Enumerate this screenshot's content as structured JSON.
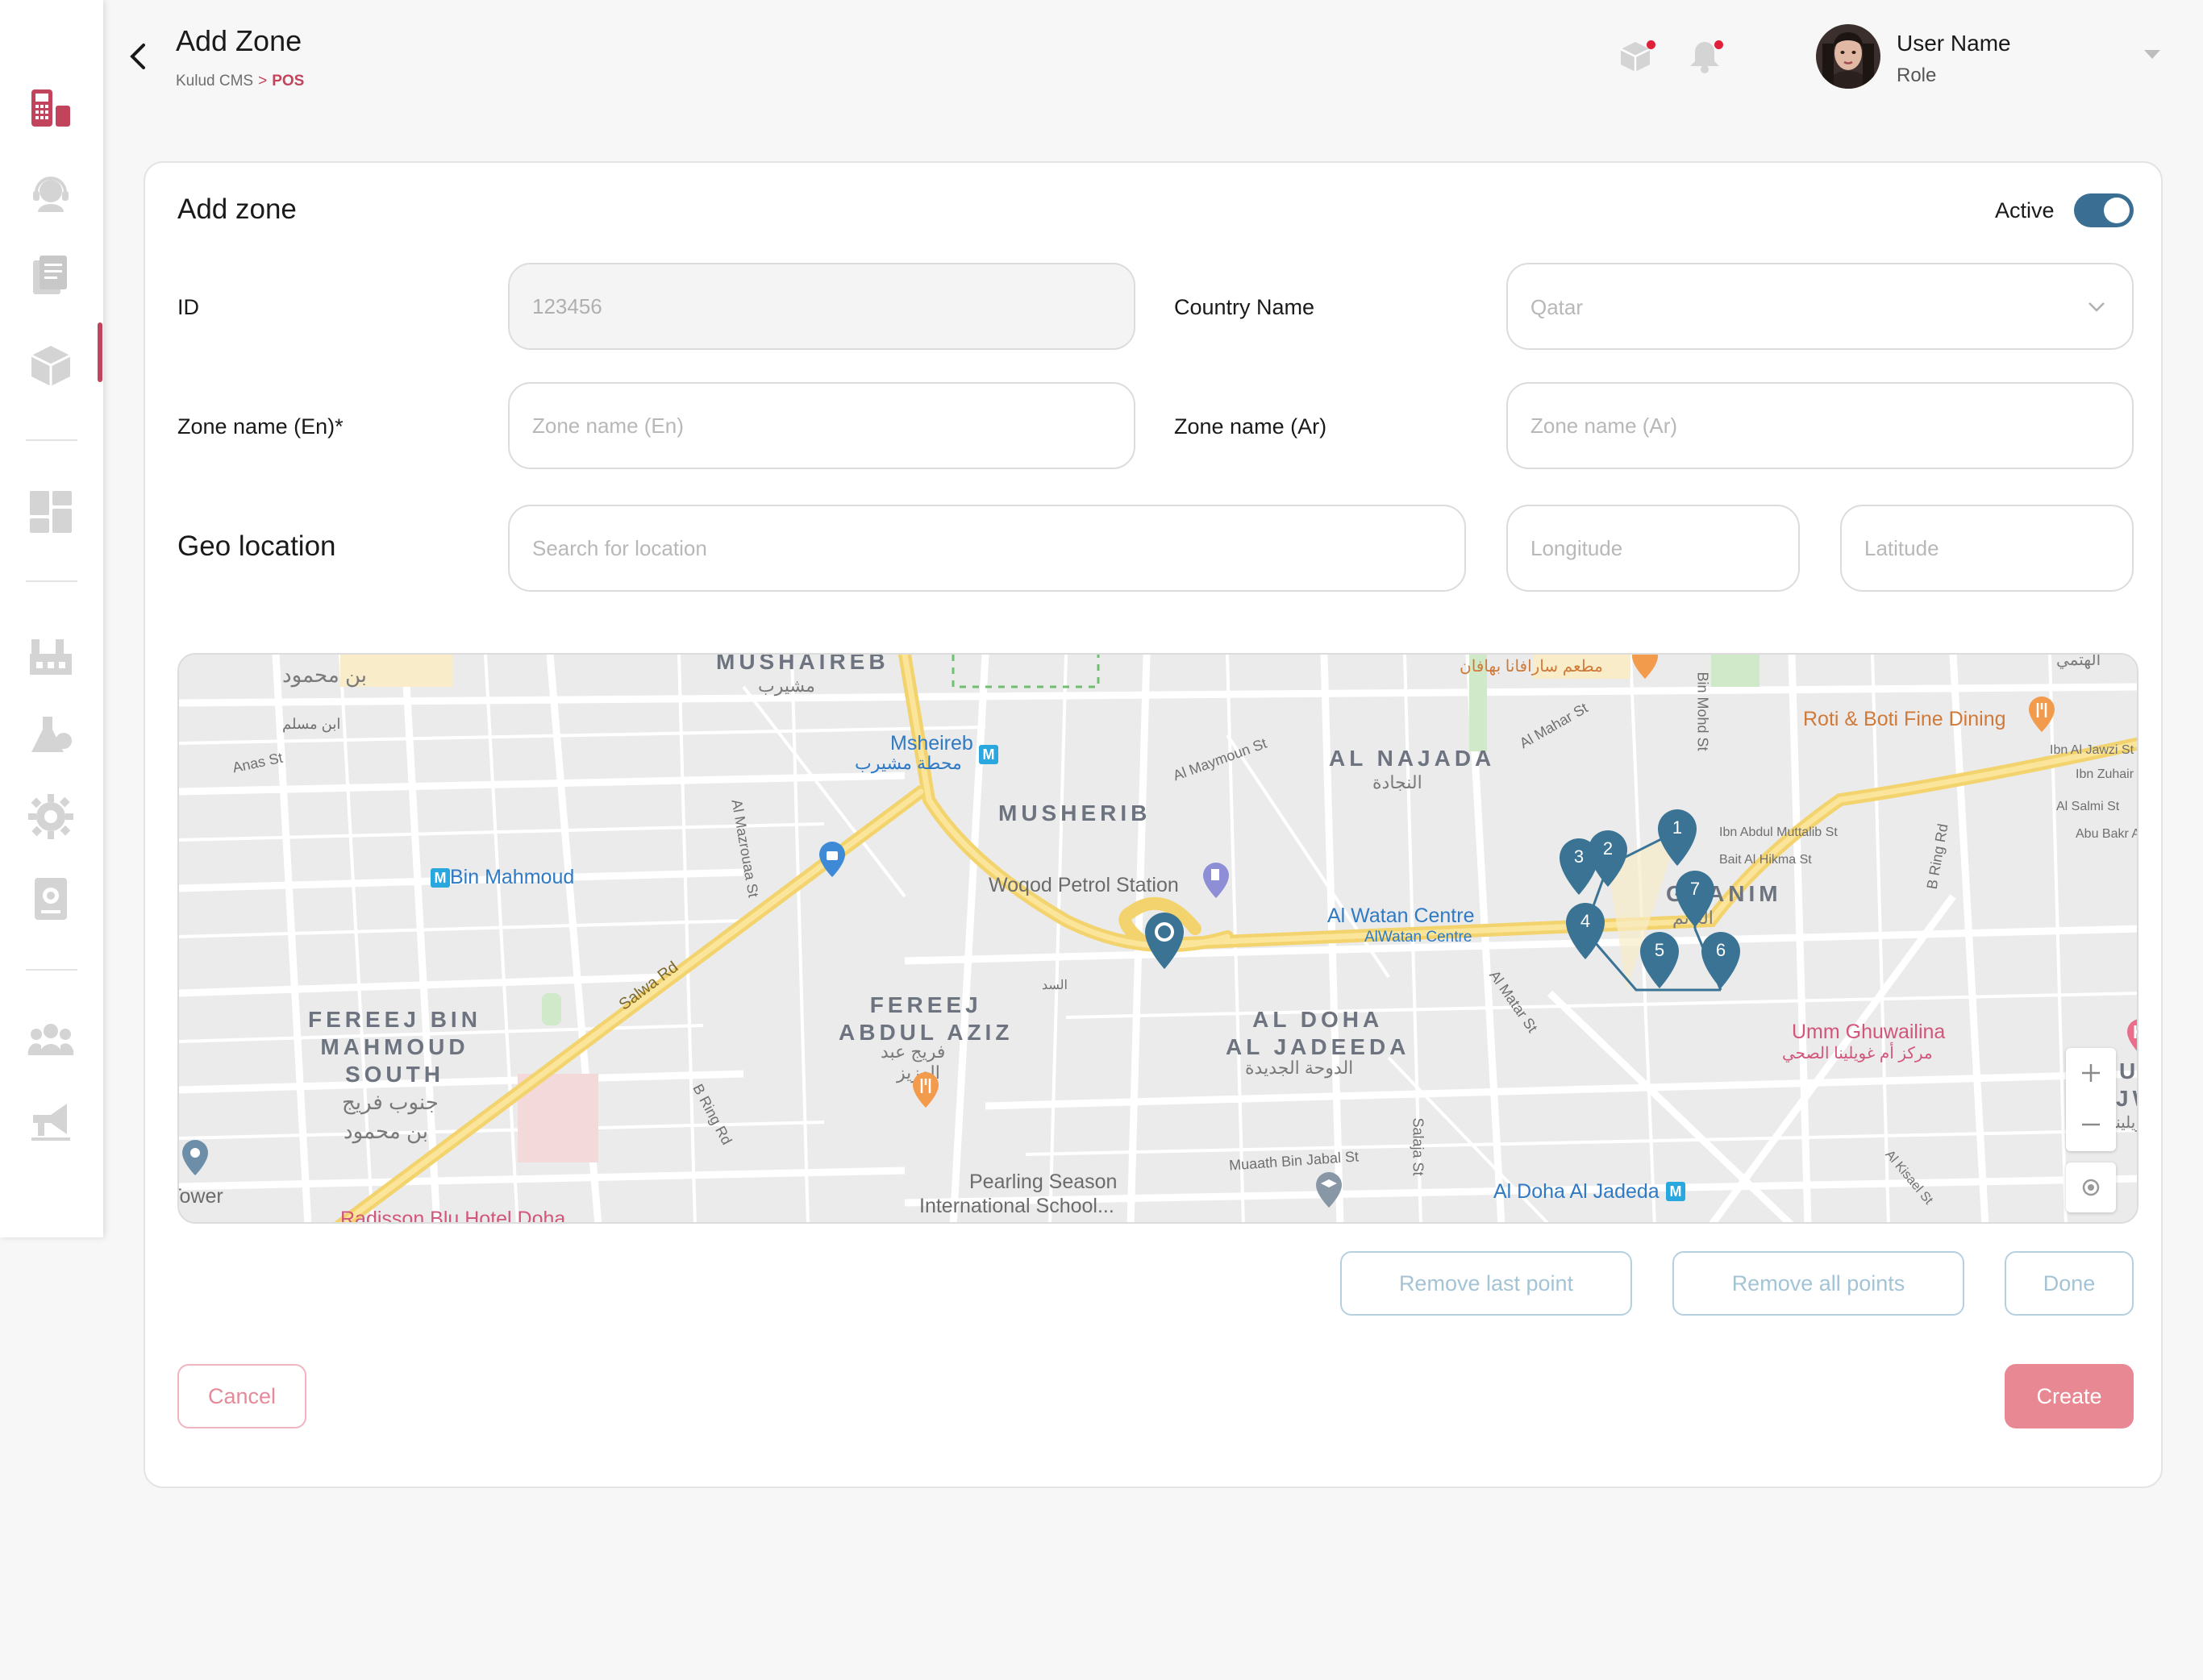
{
  "header": {
    "title": "Add Zone",
    "breadcrumb": {
      "root": "Kulud CMS",
      "separator": ">",
      "current": "POS"
    },
    "user": {
      "name": "User Name",
      "role": "Role"
    }
  },
  "sidebar": {
    "items": [
      {
        "icon": "pos-terminal-icon",
        "active": true
      },
      {
        "icon": "support-agent-icon"
      },
      {
        "icon": "documents-icon"
      },
      {
        "icon": "box-icon"
      },
      {
        "icon": "dashboard-grid-icon"
      },
      {
        "icon": "factory-icon"
      },
      {
        "icon": "lab-flask-icon"
      },
      {
        "icon": "settings-gear-icon"
      },
      {
        "icon": "device-settings-icon"
      },
      {
        "icon": "users-group-icon"
      },
      {
        "icon": "megaphone-icon"
      }
    ]
  },
  "form": {
    "title": "Add zone",
    "active_label": "Active",
    "active": true,
    "id_label": "ID",
    "id_placeholder": "123456",
    "country_label": "Country Name",
    "country_value": "Qatar",
    "zone_en_label": "Zone name (En)*",
    "zone_en_placeholder": "Zone name (En)",
    "zone_ar_label": "Zone name (Ar)",
    "zone_ar_placeholder": "Zone name (Ar)",
    "geo_label": "Geo location",
    "search_placeholder": "Search for location",
    "longitude_placeholder": "Longitude",
    "latitude_placeholder": "Latitude"
  },
  "map": {
    "labels": {
      "mushaireb": "MUSHAIREB",
      "mushaireb_ar": "مشيرب",
      "bin_mahmoud_ar": "بن محمود",
      "ibn_muslim_ar": "ابن مسلم",
      "anas_st": "Anas St",
      "msheireb": "Msheireb",
      "msheireb_ar": "محطة مشيرب",
      "al_mazrouaa_st": "Al Mazrouaa St",
      "al_maymoun_st": "Al Maymoun St",
      "al_najada": "AL NAJADA",
      "al_najada_ar": "النجادة",
      "al_mahar_st": "Al Mahar St",
      "restaurant_ar": "مطعم سارافانا بهافان",
      "bin_mohd_st": "Bin Mohd St",
      "roti_boti": "Roti & Boti Fine Dining",
      "ibn_al_jawzi": "Ibn Al Jawzi St",
      "ibn_zuhair": "Ibn Zuhair",
      "al_salmi": "Al Salmi St",
      "abu_bakr": "Abu Bakr A",
      "ibn_abdul": "Ibn Abdul Muttalib St",
      "bait_al_hikma": "Bait Al Hikma St",
      "b_ring_rd": "B Ring Rd",
      "musherib": "MUSHERIB",
      "bin_mahmoud": "Bin Mahmoud",
      "woqod": "Woqod Petrol Station",
      "al_watan": "Al Watan Centre",
      "al_watan2": "AlWatan Centre",
      "ghanim": "GHANIM",
      "ghanim_ar": "الغانم",
      "al_matar_st": "Al Matar St",
      "salwa_rd": "Salwa Rd",
      "fereej_bin_mahmoud": "FEREEJ BIN\nMAHMOUD\nSOUTH",
      "fereej_bin_mahmoud_ar1": "جنوب فريج",
      "fereej_bin_mahmoud_ar2": "بن محمود",
      "fereej_abdul_aziz": "FEREEJ\nABDUL AZIZ",
      "fereej_abdul_aziz_ar1": "فريج عبد",
      "fereej_abdul_aziz_ar2": "العزيز",
      "al_doha": "AL DOHA\nAL JADEEDA",
      "al_doha_ar": "الدوحة الجديدة",
      "al_sadd_ar": "السد",
      "umm_ghuwailina": "Umm Ghuwailina",
      "umm_ghuwailina_ar": "مركز أم غويلينا الصحي",
      "b_ring_rd2": "B Ring Rd",
      "salaja_st": "Salaja St",
      "muaath": "Muaath Bin Jabal St",
      "pearling": "Pearling Season",
      "pearling2": "International School...",
      "al_doha_jadeda": "Al Doha Al Jadeda",
      "al_kisael": "Al Kisael St",
      "tower": "Tower",
      "radisson": "Radisson Blu Hotel Doha",
      "al_hetmi_ar": "الهتمي",
      "edge_u": "UI",
      "edge_w": "JW",
      "edge_ar": "ويلينا",
      "metro_letter": "M"
    },
    "points": [
      "1",
      "2",
      "3",
      "4",
      "5",
      "6",
      "7"
    ]
  },
  "actions": {
    "remove_last": "Remove last point",
    "remove_all": "Remove all points",
    "done": "Done",
    "cancel": "Cancel",
    "create": "Create"
  },
  "colors": {
    "accent": "#c2445c",
    "primary": "#3a6f93",
    "create_button": "#e88893",
    "pin": "#3a7393"
  }
}
